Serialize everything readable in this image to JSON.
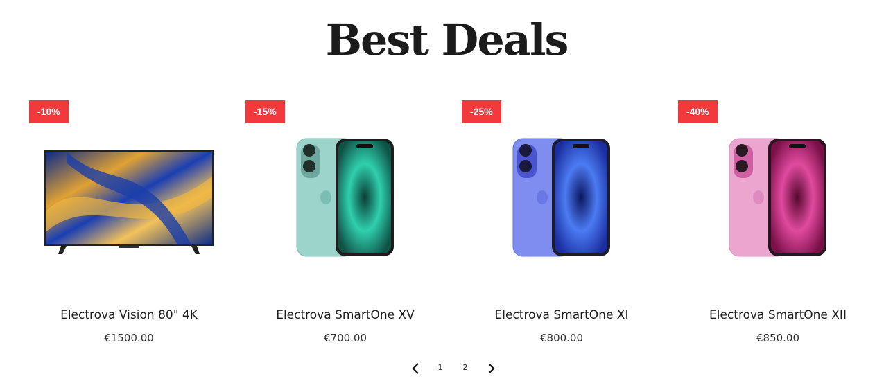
{
  "section": {
    "title": "Best Deals"
  },
  "products": [
    {
      "badge": "-10%",
      "name": "Electrova Vision 80\" 4K",
      "price": "€1500.00",
      "image": "tv-image"
    },
    {
      "badge": "-15%",
      "name": "Electrova SmartOne XV",
      "price": "€700.00",
      "image": "phone-teal-image",
      "color": "#2fb59c"
    },
    {
      "badge": "-25%",
      "name": "Electrova SmartOne XI",
      "price": "€800.00",
      "image": "phone-blue-image",
      "color": "#3d58e0"
    },
    {
      "badge": "-40%",
      "name": "Electrova SmartOne XII",
      "price": "€850.00",
      "image": "phone-pink-image",
      "color": "#d8338f"
    }
  ],
  "pagination": {
    "pages": [
      "1",
      "2"
    ],
    "current": "1",
    "prev_icon": "chevron-left-icon",
    "next_icon": "chevron-right-icon"
  },
  "colors": {
    "badge": "#f23a3c",
    "title": "#1b1b1b"
  }
}
